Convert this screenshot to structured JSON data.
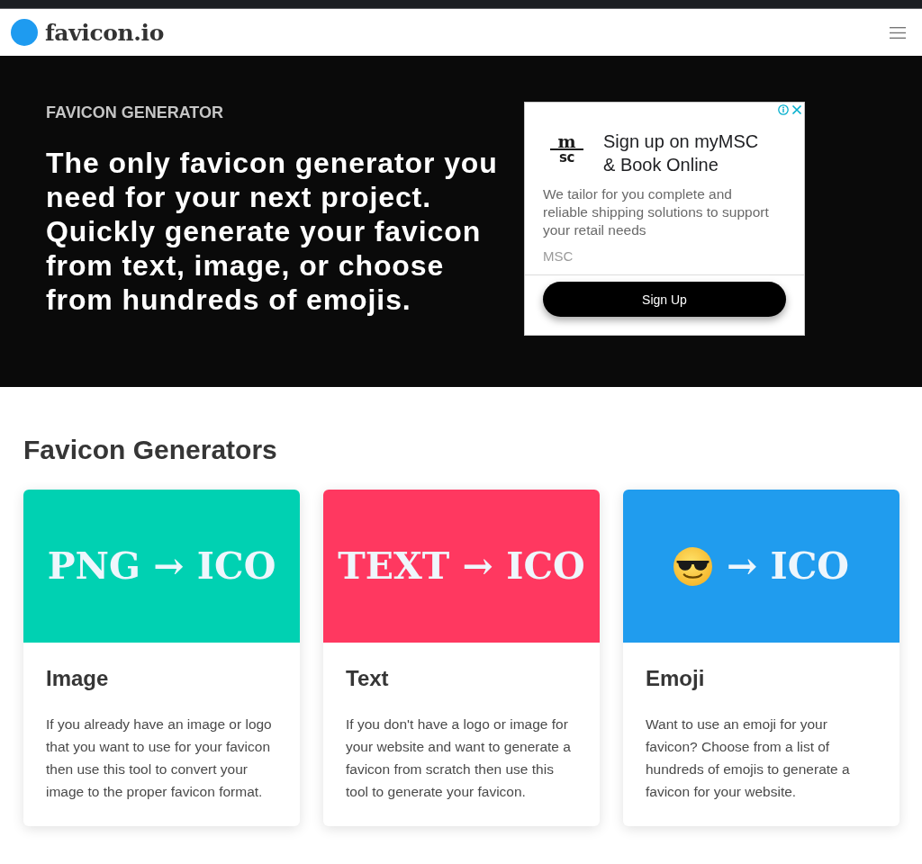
{
  "navbar": {
    "logo_text": "favicon.io"
  },
  "hero": {
    "eyebrow": "FAVICON GENERATOR",
    "headline": "The only favicon generator you need for your next project. Quickly generate your favicon from text, image, or choose from hundreds of emojis."
  },
  "ad": {
    "logo": {
      "top": "m",
      "bottom": "sc"
    },
    "title": "Sign up on myMSC & Book Online",
    "description": "We tailor for you complete and reliable shipping solutions to support your retail needs",
    "advertiser": "MSC",
    "button": "Sign Up"
  },
  "generators": {
    "heading": "Favicon Generators",
    "cards": [
      {
        "banner": {
          "kind": "text",
          "text": "PNG → ICO"
        },
        "color": "#00d1b2",
        "title": "Image",
        "description": "If you already have an image or logo that you want to use for your favicon then use this tool to convert your image to the proper favicon format."
      },
      {
        "banner": {
          "kind": "text",
          "text": "TEXT → ICO"
        },
        "color": "#ff3860",
        "title": "Text",
        "description": "If you don't have a logo or image for your website and want to generate a favicon from scratch then use this tool to generate your favicon."
      },
      {
        "banner": {
          "kind": "emoji",
          "text": "→ ICO"
        },
        "color": "#209cee",
        "title": "Emoji",
        "description": "Want to use an emoji for your favicon? Choose from a list of hundreds of emojis to generate a favicon for your website."
      }
    ]
  }
}
